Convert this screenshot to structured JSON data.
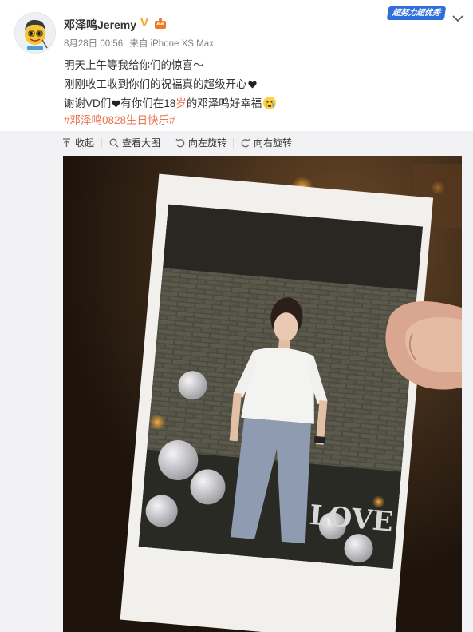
{
  "post": {
    "username": "邓泽鸣Jeremy",
    "verified_badge": "V",
    "date": "8月28日 00:56",
    "source": "来自 iPhone XS Max",
    "promo_tag": "超努力超优秀",
    "text": {
      "line1": "明天上午等我给你们的惊喜～",
      "line2": "刚刚收工收到你们的祝福真的超级开心",
      "line3_prefix": "谢谢VD们",
      "line3_mid": "有你们在18",
      "line3_highlight": "岁",
      "line3_suffix": "的邓泽鸣好幸福",
      "hashtag": "#邓泽鸣0828生日快乐#"
    }
  },
  "toolbar": {
    "collapse": "收起",
    "view_large": "查看大图",
    "rotate_left": "向左旋转",
    "rotate_right": "向右旋转"
  },
  "photo": {
    "sign_text": "LOVE"
  },
  "colors": {
    "link_orange": "#eb7350",
    "promo_blue": "#2f6fd8",
    "verified_gold": "#f5a623",
    "panel_bg": "#f2f2f5"
  },
  "icons": [
    "avatar",
    "verified-v-icon",
    "crown-icon",
    "chevron-down-icon",
    "heart-icon",
    "crying-emoji-icon",
    "collapse-arrow-icon",
    "magnifier-icon",
    "rotate-left-icon",
    "rotate-right-icon"
  ]
}
